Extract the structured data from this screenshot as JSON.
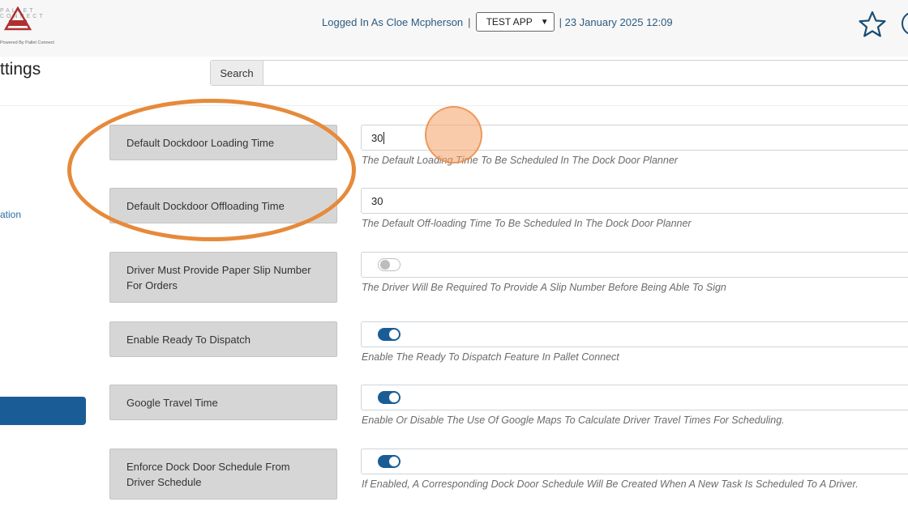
{
  "header": {
    "logo": {
      "brand_top": "PALLET CONNECT",
      "badge": "TEST",
      "powered_by": "Powered By Pallet Connect"
    },
    "logged_in_text": "Logged In As Cloe Mcpherson",
    "separator": "|",
    "app_select": "TEST APP",
    "datetime": "| 23 January 2025 12:09",
    "star_icon": "star-icon"
  },
  "page": {
    "title": "ttings",
    "search_label": "Search",
    "search_placeholder": ""
  },
  "sidebar": {
    "partial_link": "ation"
  },
  "settings": [
    {
      "label": "Default Dockdoor Loading Time",
      "value": "30",
      "help": "The Default Loading Time To Be Scheduled In The Dock Door Planner"
    },
    {
      "label": "Default Dockdoor Offloading Time",
      "value": "30",
      "help": "The Default Off-loading Time To Be Scheduled In The Dock Door Planner"
    },
    {
      "label": "Driver Must Provide Paper Slip Number For Orders",
      "toggle": "off",
      "help": "The Driver Will Be Required To Provide A Slip Number Before Being Able To Sign"
    },
    {
      "label": "Enable Ready To Dispatch",
      "toggle": "on",
      "help": "Enable The Ready To Dispatch Feature In Pallet Connect"
    },
    {
      "label": "Google Travel Time",
      "toggle": "on",
      "help": "Enable Or Disable The Use Of Google Maps To Calculate Driver Travel Times For Scheduling."
    },
    {
      "label": "Enforce Dock Door Schedule From Driver Schedule",
      "toggle": "on",
      "help": "If Enabled, A Corresponding Dock Door Schedule Will Be Created When A New Task Is Scheduled To A Driver."
    }
  ],
  "colors": {
    "accent": "#1a5d96",
    "highlight": "#e68a3a"
  }
}
